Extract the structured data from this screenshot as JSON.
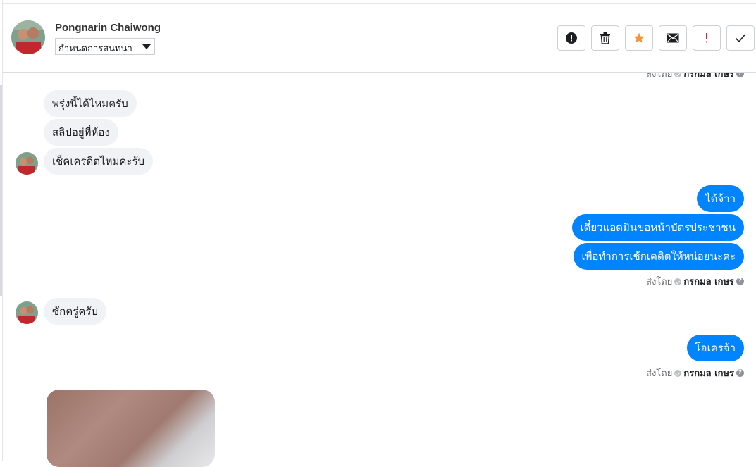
{
  "header": {
    "contact_name": "Pongnarin Chaiwong",
    "conversation_select": "กำหนดการสนทนา",
    "actions": [
      {
        "name": "report-button",
        "icon": "exclamation-circle-icon"
      },
      {
        "name": "delete-button",
        "icon": "trash-icon"
      },
      {
        "name": "star-button",
        "icon": "star-icon",
        "color": "#f7923a"
      },
      {
        "name": "mark-unread-button",
        "icon": "envelope-icon"
      },
      {
        "name": "important-button",
        "icon": "exclamation-icon",
        "color": "#e41e3f"
      },
      {
        "name": "done-button",
        "icon": "check-icon"
      }
    ]
  },
  "messages": {
    "sent_by_label": "ส่งโดย",
    "sent_by_name": "กรกมล เกษร",
    "incoming_1": "พรุ่งนี้ได้ไหมครับ",
    "incoming_2": "สลิปอยู่ที่ห้อง",
    "incoming_3": "เช็คเครดิตไหมคะรับ",
    "outgoing_1": "ได้จ้าา",
    "outgoing_2": "เดี๋ยวแอดมินขอหน้าบัตรประชาชน",
    "outgoing_3": "เพื่อทำการเช้กเคดิตให้หน่อยนะคะ",
    "incoming_4": "ซักครู่ครับ",
    "outgoing_4": "โอเครจ้า"
  },
  "colors": {
    "outgoing_bubble": "#0084ff",
    "incoming_bubble": "#f0f2f5"
  }
}
